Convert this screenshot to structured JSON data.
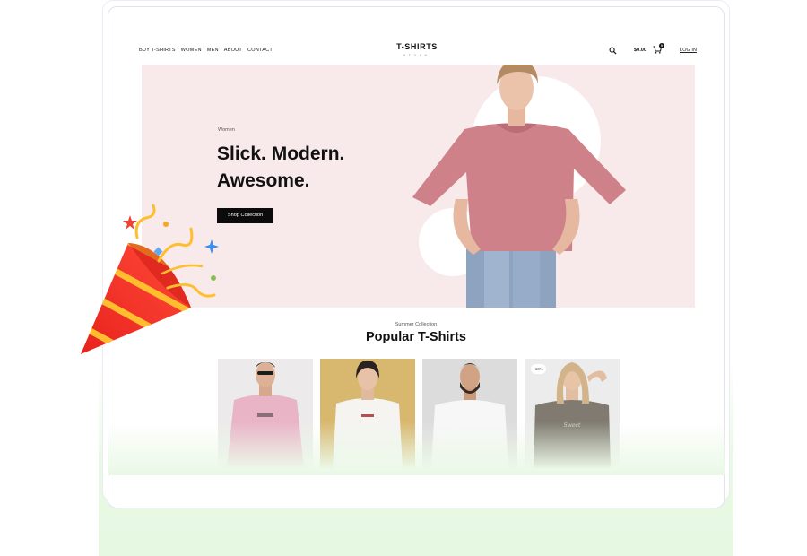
{
  "header": {
    "nav": [
      "BUY T-SHIRTS",
      "WOMEN",
      "MEN",
      "ABOUT",
      "CONTACT"
    ],
    "logo_title": "T-SHIRTS",
    "logo_subtitle": "store",
    "cart_price": "$0.00",
    "cart_count": "0",
    "login_label": "LOG IN"
  },
  "hero": {
    "tag": "Women",
    "title": "Slick. Modern.\nAwesome.",
    "button_label": "Shop Collection"
  },
  "section": {
    "subtitle": "Summer Collection",
    "title": "Popular T-Shirts"
  },
  "products": [
    {
      "name": "man-pink-tshirt"
    },
    {
      "name": "woman-white-tshirt"
    },
    {
      "name": "bearded-man-white-tshirt"
    },
    {
      "name": "woman-grey-tshirt",
      "badge": "-10%"
    }
  ],
  "colors": {
    "hero_bg": "#f8eaea",
    "accent_black": "#0b0b0b",
    "glow_green": "#e8f8e4"
  },
  "icons": [
    "search-icon",
    "cart-icon",
    "party-popper-icon"
  ]
}
